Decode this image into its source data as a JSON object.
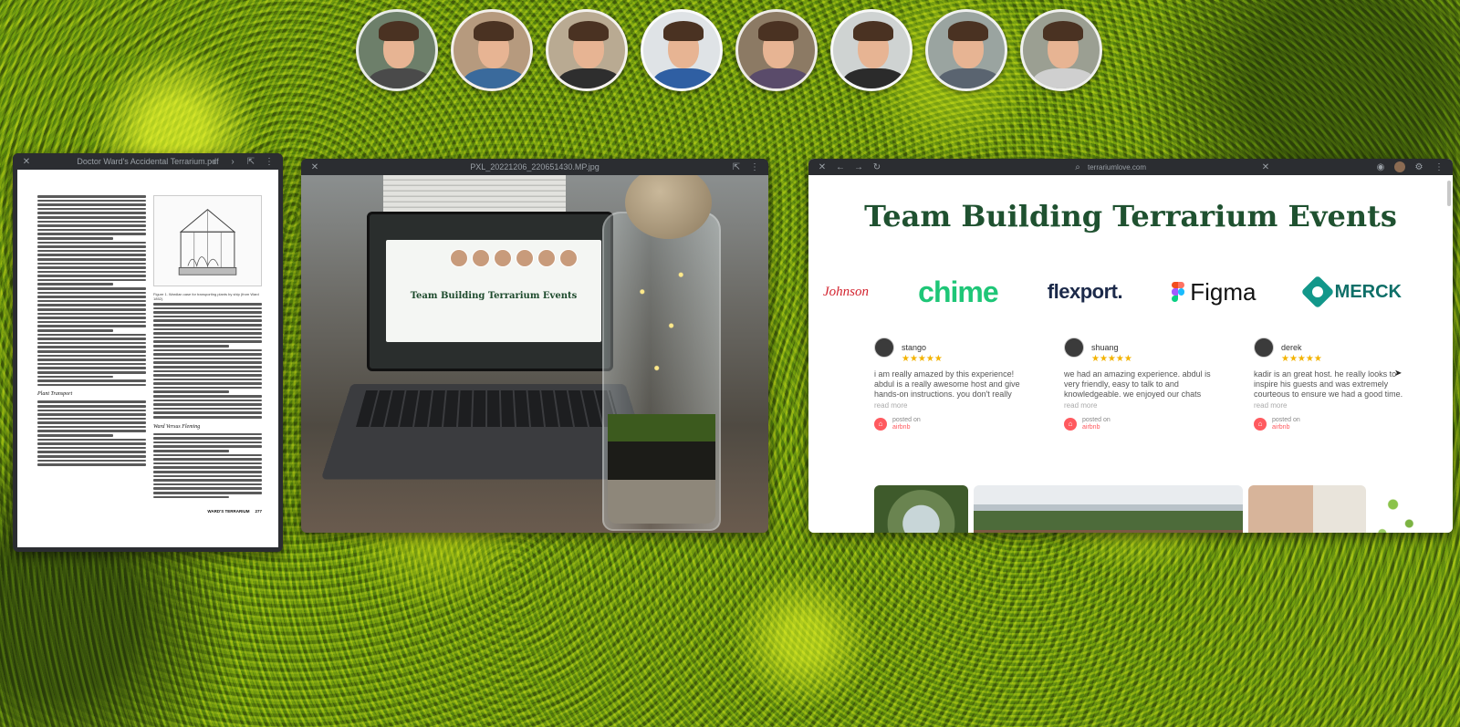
{
  "participants": [
    {
      "name": "participant-1",
      "shirt": "#4a4a4a",
      "bg": "#6d7f6a"
    },
    {
      "name": "participant-2",
      "shirt": "#3a6a9c",
      "bg": "#b69a7e"
    },
    {
      "name": "participant-3",
      "shirt": "#2e2e2e",
      "bg": "#b9aa92"
    },
    {
      "name": "participant-4",
      "shirt": "#2f5fa3",
      "bg": "#dfe3e6"
    },
    {
      "name": "participant-5",
      "shirt": "#5a4b6a",
      "bg": "#8c7a64"
    },
    {
      "name": "participant-6",
      "shirt": "#2b2b2b",
      "bg": "#cfd3d2"
    },
    {
      "name": "participant-7",
      "shirt": "#5a6470",
      "bg": "#9aa4a0"
    },
    {
      "name": "participant-8",
      "shirt": "#cfcfcf",
      "bg": "#9b9f92"
    }
  ],
  "pdf": {
    "title": "Doctor Ward's Accidental Terrarium.pdf",
    "heading_plant_transport": "Plant Transport",
    "heading_ward_vs_fleming": "Ward Versus Fleming",
    "figure_caption": "Figure 1. Wardian case for transporting plants by ship (from Ward 1852).",
    "footer_label": "WARD'S TERRARIUM",
    "footer_page": "277"
  },
  "photo": {
    "title": "PXL_20221206_220651430.MP.jpg",
    "screen_title": "Team Building Terrarium Events"
  },
  "browser": {
    "url": "terrariumlove.com",
    "page_title": "Team Building Terrarium Events",
    "logos": [
      "Johnson",
      "chime",
      "flexport.",
      "Figma",
      "MERCK"
    ],
    "reviews": [
      {
        "name": "stango",
        "stars": "★★★★★",
        "text": "i am really amazed by this experience! abdul is a really awesome host and give hands-on instructions. you don't really",
        "read_more": "read more",
        "posted_on": "posted on",
        "platform": "airbnb"
      },
      {
        "name": "shuang",
        "stars": "★★★★★",
        "text": "we had an amazing experience. abdul is very friendly, easy to talk to and knowledgeable. we enjoyed our chats",
        "read_more": "read more",
        "posted_on": "posted on",
        "platform": "airbnb"
      },
      {
        "name": "derek",
        "stars": "★★★★★",
        "text": "kadir is an great host. he really looks to inspire his guests and was extremely courteous to ensure we had a good time.",
        "read_more": "read more",
        "posted_on": "posted on",
        "platform": "airbnb"
      }
    ]
  },
  "colors": {
    "title_green": "#1f5130",
    "chime_green": "#1ec677",
    "airbnb_red": "#ff5a5f",
    "star_yellow": "#f3b300"
  }
}
